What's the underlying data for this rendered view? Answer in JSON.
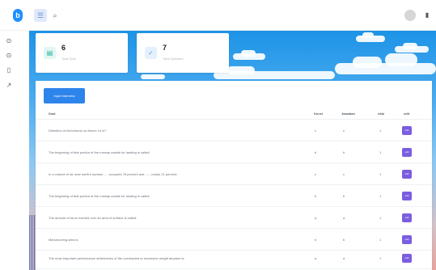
{
  "topbar": {
    "logo_text": "b",
    "menu_icon": "menu-icon",
    "search_icon": "search-icon",
    "avatar": "user-avatar",
    "right_icon": "document-icon"
  },
  "sidebar": {
    "items": [
      {
        "icon": "circle-icon",
        "glyph": "⊙"
      },
      {
        "icon": "circle-icon",
        "glyph": "⊙"
      },
      {
        "icon": "document-icon",
        "glyph": "▯"
      },
      {
        "icon": "pin-icon",
        "glyph": "↗"
      }
    ]
  },
  "stats": [
    {
      "value": "6",
      "label": "Total Quiz",
      "icon": "quiz-icon",
      "glyph": "▤",
      "color": "#1bb39a",
      "bg": "#e2f6f2"
    },
    {
      "value": "7",
      "label": "Total Question",
      "icon": "check-icon",
      "glyph": "✓",
      "color": "#4c9be8",
      "bg": "#e5f0fc"
    }
  ],
  "table": {
    "add_button": "Input Interview",
    "headers": [
      "Soal",
      "Kunci",
      "Jawaban",
      "nilai",
      "edit"
    ],
    "edit_label": "edit",
    "rows": [
      {
        "soal": "Definition of Aerodrome on Annex 14 is?",
        "kunci": "c",
        "jawaban": "c",
        "nilai": "1"
      },
      {
        "soal": "The beginning of that portion of the runway usable for landing is called:",
        "kunci": "b",
        "jawaban": "b",
        "nilai": "1"
      },
      {
        "soal": "In a volume of air near earth's surface.......occupies 78 percent and .......nearly 21 percent:",
        "kunci": "c",
        "jawaban": "c",
        "nilai": "1"
      },
      {
        "soal": "The beginning of that portion of the runway usable for landing is called:",
        "kunci": "b",
        "jawaban": "b",
        "nilai": "1"
      },
      {
        "soal": "The amount of force exerted over an area of surface is called:",
        "kunci": "a",
        "jawaban": "a",
        "nilai": "1"
      },
      {
        "soal": "Manoeuvring area is:",
        "kunci": "b",
        "jawaban": "b",
        "nilai": "1"
      },
      {
        "soal": "The most important performance deficiencies of the overloaded or excessive weight airplane is:",
        "kunci": "a",
        "jawaban": "a",
        "nilai": "1"
      }
    ]
  },
  "colors": {
    "accent": "#2d84ea",
    "edit": "#7a5ee0",
    "logo": "#1e90ff"
  }
}
